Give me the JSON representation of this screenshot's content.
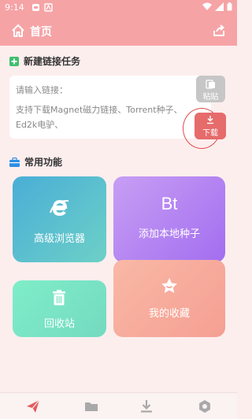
{
  "status_bar": {
    "time": "9:14"
  },
  "header": {
    "title": "首页"
  },
  "new_task": {
    "title": "新建链接任务",
    "placeholder": "请输入链接：",
    "hint": "支持下载Magnet磁力链接、Torrent种子、Ed2k电驴、",
    "paste_label": "粘贴",
    "download_label": "下载"
  },
  "functions": {
    "title": "常用功能",
    "browser_label": "高级浏览器",
    "bt_icon_text": "Bt",
    "bt_label": "添加本地种子",
    "recycle_label": "回收站",
    "favorites_label": "我的收藏"
  },
  "nav": {
    "items": [
      {
        "icon": "send-icon"
      },
      {
        "icon": "folder-icon"
      },
      {
        "icon": "download-icon"
      },
      {
        "icon": "settings-icon"
      }
    ]
  },
  "colors": {
    "header_bg": "#f6a3a6",
    "page_bg": "#fdeeee",
    "accent_red": "#e66b6b"
  }
}
